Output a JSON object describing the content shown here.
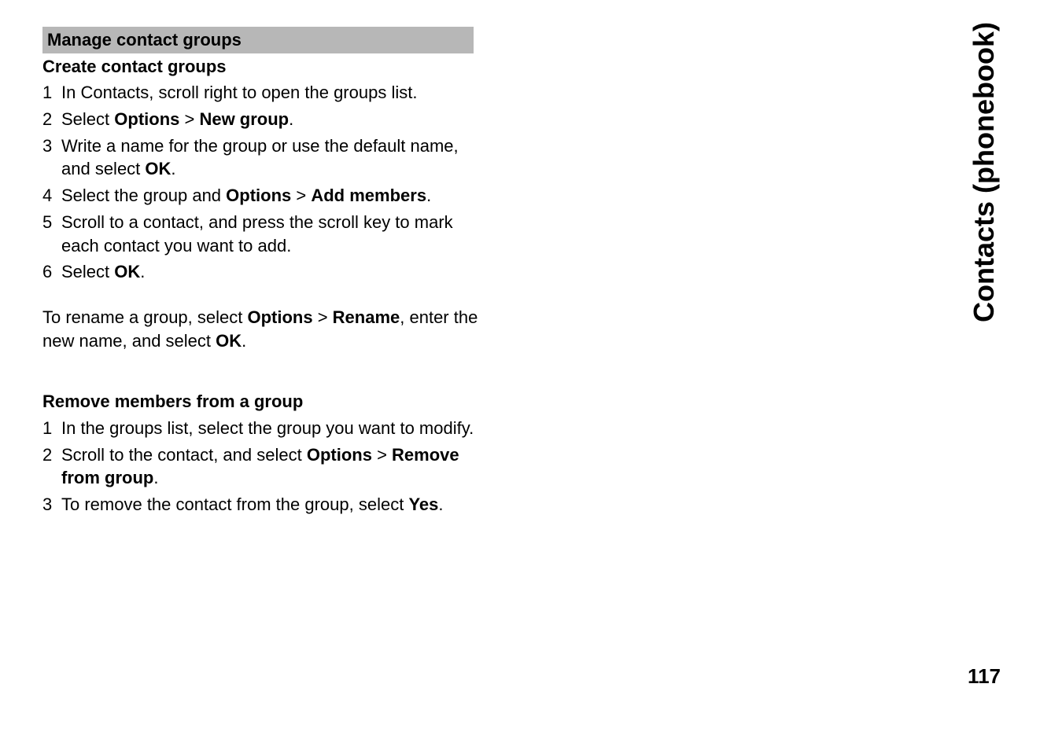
{
  "sidebar": {
    "title": "Contacts (phonebook)"
  },
  "page_number": "117",
  "section_title": "Manage contact groups",
  "create": {
    "title": "Create contact groups",
    "steps": [
      {
        "num": "1",
        "text": "In Contacts, scroll right to open the groups list."
      },
      {
        "num": "2",
        "parts": {
          "p0": "Select ",
          "b0": "Options",
          "p1": "  > ",
          "b1": "New group",
          "p2": "."
        }
      },
      {
        "num": "3",
        "parts": {
          "p0": "Write a name for the group or use the default name, and select ",
          "b0": "OK",
          "p1": "."
        }
      },
      {
        "num": "4",
        "parts": {
          "p0": "Select the group and ",
          "b0": "Options",
          "p1": "  > ",
          "b1": "Add members",
          "p2": "."
        }
      },
      {
        "num": "5",
        "text": "Scroll to a contact, and press the scroll key to mark each contact you want to add."
      },
      {
        "num": "6",
        "parts": {
          "p0": "Select ",
          "b0": "OK",
          "p1": "."
        }
      }
    ],
    "rename": {
      "p0": "To rename a group, select ",
      "b0": "Options",
      "p1": "  > ",
      "b1": "Rename",
      "p2": ", enter the new name, and select ",
      "b2": "OK",
      "p3": "."
    }
  },
  "remove": {
    "title": "Remove members from a group",
    "steps": [
      {
        "num": "1",
        "text": "In the groups list, select the group you want to modify."
      },
      {
        "num": "2",
        "parts": {
          "p0": "Scroll to the contact, and select ",
          "b0": "Options",
          "p1": "  > ",
          "b1": "Remove from group",
          "p2": "."
        }
      },
      {
        "num": "3",
        "parts": {
          "p0": "To remove the contact from the group, select ",
          "b0": "Yes",
          "p1": "."
        }
      }
    ]
  }
}
